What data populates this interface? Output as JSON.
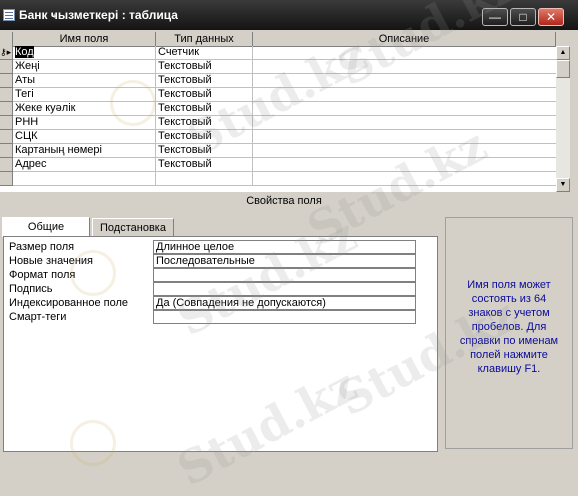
{
  "window": {
    "title": "Банк ҹызметкері : таблица",
    "buttons": {
      "minimize": "—",
      "maximize": "□",
      "close": "✕"
    }
  },
  "grid": {
    "headers": [
      "Имя поля",
      "Тип данных",
      "Описание"
    ],
    "rows": [
      {
        "name": "Код",
        "type": "Счетчик",
        "desc": ""
      },
      {
        "name": "Жеңі",
        "type": "Текстовый",
        "desc": ""
      },
      {
        "name": "Аты",
        "type": "Текстовый",
        "desc": ""
      },
      {
        "name": "Тегі",
        "type": "Текстовый",
        "desc": ""
      },
      {
        "name": "Жеке куәлік",
        "type": "Текстовый",
        "desc": ""
      },
      {
        "name": "РНН",
        "type": "Текстовый",
        "desc": ""
      },
      {
        "name": "СЦК",
        "type": "Текстовый",
        "desc": ""
      },
      {
        "name": "Картаның нөмері",
        "type": "Текстовый",
        "desc": ""
      },
      {
        "name": "Адрес",
        "type": "Текстовый",
        "desc": ""
      }
    ]
  },
  "properties": {
    "section_label": "Свойства поля",
    "tabs": [
      "Общие",
      "Подстановка"
    ],
    "rows": [
      {
        "label": "Размер поля",
        "value": "Длинное целое"
      },
      {
        "label": "Новые значения",
        "value": "Последовательные"
      },
      {
        "label": "Формат поля",
        "value": ""
      },
      {
        "label": "Подпись",
        "value": ""
      },
      {
        "label": "Индексированное поле",
        "value": "Да (Совпадения не допускаются)"
      },
      {
        "label": "Смарт-теги",
        "value": ""
      }
    ],
    "help_text": "Имя поля может состоять из 64 знаков с учетом пробелов.  Для справки по именам полей нажмите клавишу F1."
  },
  "watermark": "Stud.kz"
}
